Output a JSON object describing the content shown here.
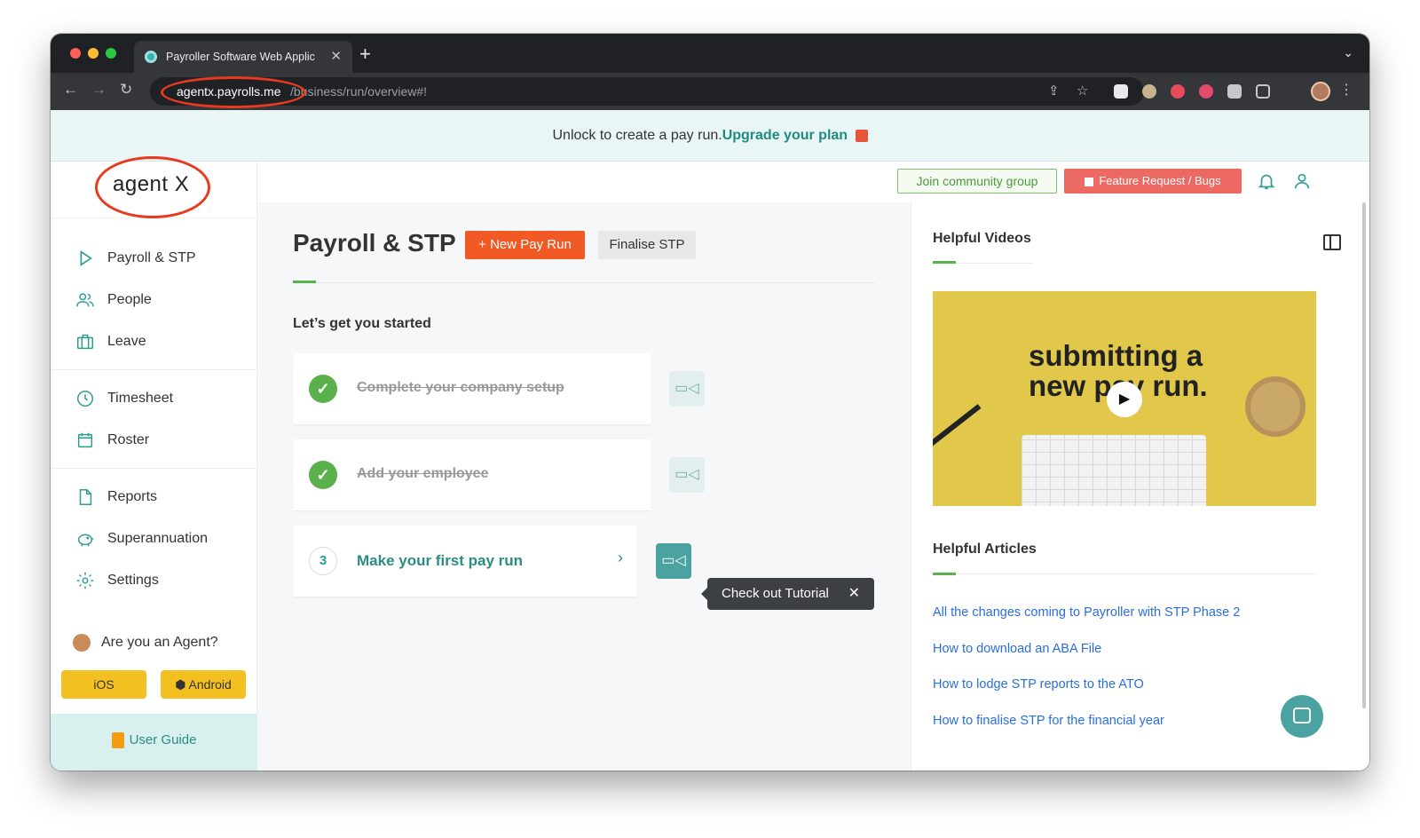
{
  "browser": {
    "tab_title": "Payroller Software Web Applic",
    "url_host": "agentx.payrolls.me",
    "url_path": "/business/run/overview#!"
  },
  "banner": {
    "text": "Unlock to create a pay run.",
    "link": "Upgrade your plan"
  },
  "logo": {
    "text": "agent X"
  },
  "sidebar": {
    "items": [
      {
        "label": "Payroll & STP"
      },
      {
        "label": "People"
      },
      {
        "label": "Leave"
      },
      {
        "label": "Timesheet"
      },
      {
        "label": "Roster"
      },
      {
        "label": "Reports"
      },
      {
        "label": "Superannuation"
      },
      {
        "label": "Settings"
      }
    ],
    "agent_prompt": "Are you an Agent?",
    "ios": "iOS",
    "android": "Android",
    "user_guide": "User Guide"
  },
  "header": {
    "join_label": "Join community group",
    "feature_label": "Feature Request / Bugs"
  },
  "main": {
    "title": "Payroll & STP",
    "new_pay_run": "+ New Pay Run",
    "finalise_stp": "Finalise STP",
    "started": "Let’s get you started",
    "steps": [
      {
        "label": "Complete your company setup",
        "done": true
      },
      {
        "label": "Add your employee",
        "done": true
      },
      {
        "number": "3",
        "label": "Make your first pay run",
        "done": false
      }
    ],
    "tooltip": "Check out Tutorial"
  },
  "right": {
    "videos_title": "Helpful Videos",
    "video_headline_1": "submitting a",
    "video_headline_2": "new pay run.",
    "articles_title": "Helpful Articles",
    "articles": [
      "All the changes coming to Payroller with STP Phase 2",
      "How to download an ABA File",
      "How to lodge STP reports to the ATO",
      "How to finalise STP for the financial year"
    ]
  },
  "colors": {
    "primary": "#2a9d8f",
    "orange": "#f15a24",
    "green": "#5ab04a",
    "coral": "#ec6a63",
    "annotation_red": "#e83a1e"
  }
}
